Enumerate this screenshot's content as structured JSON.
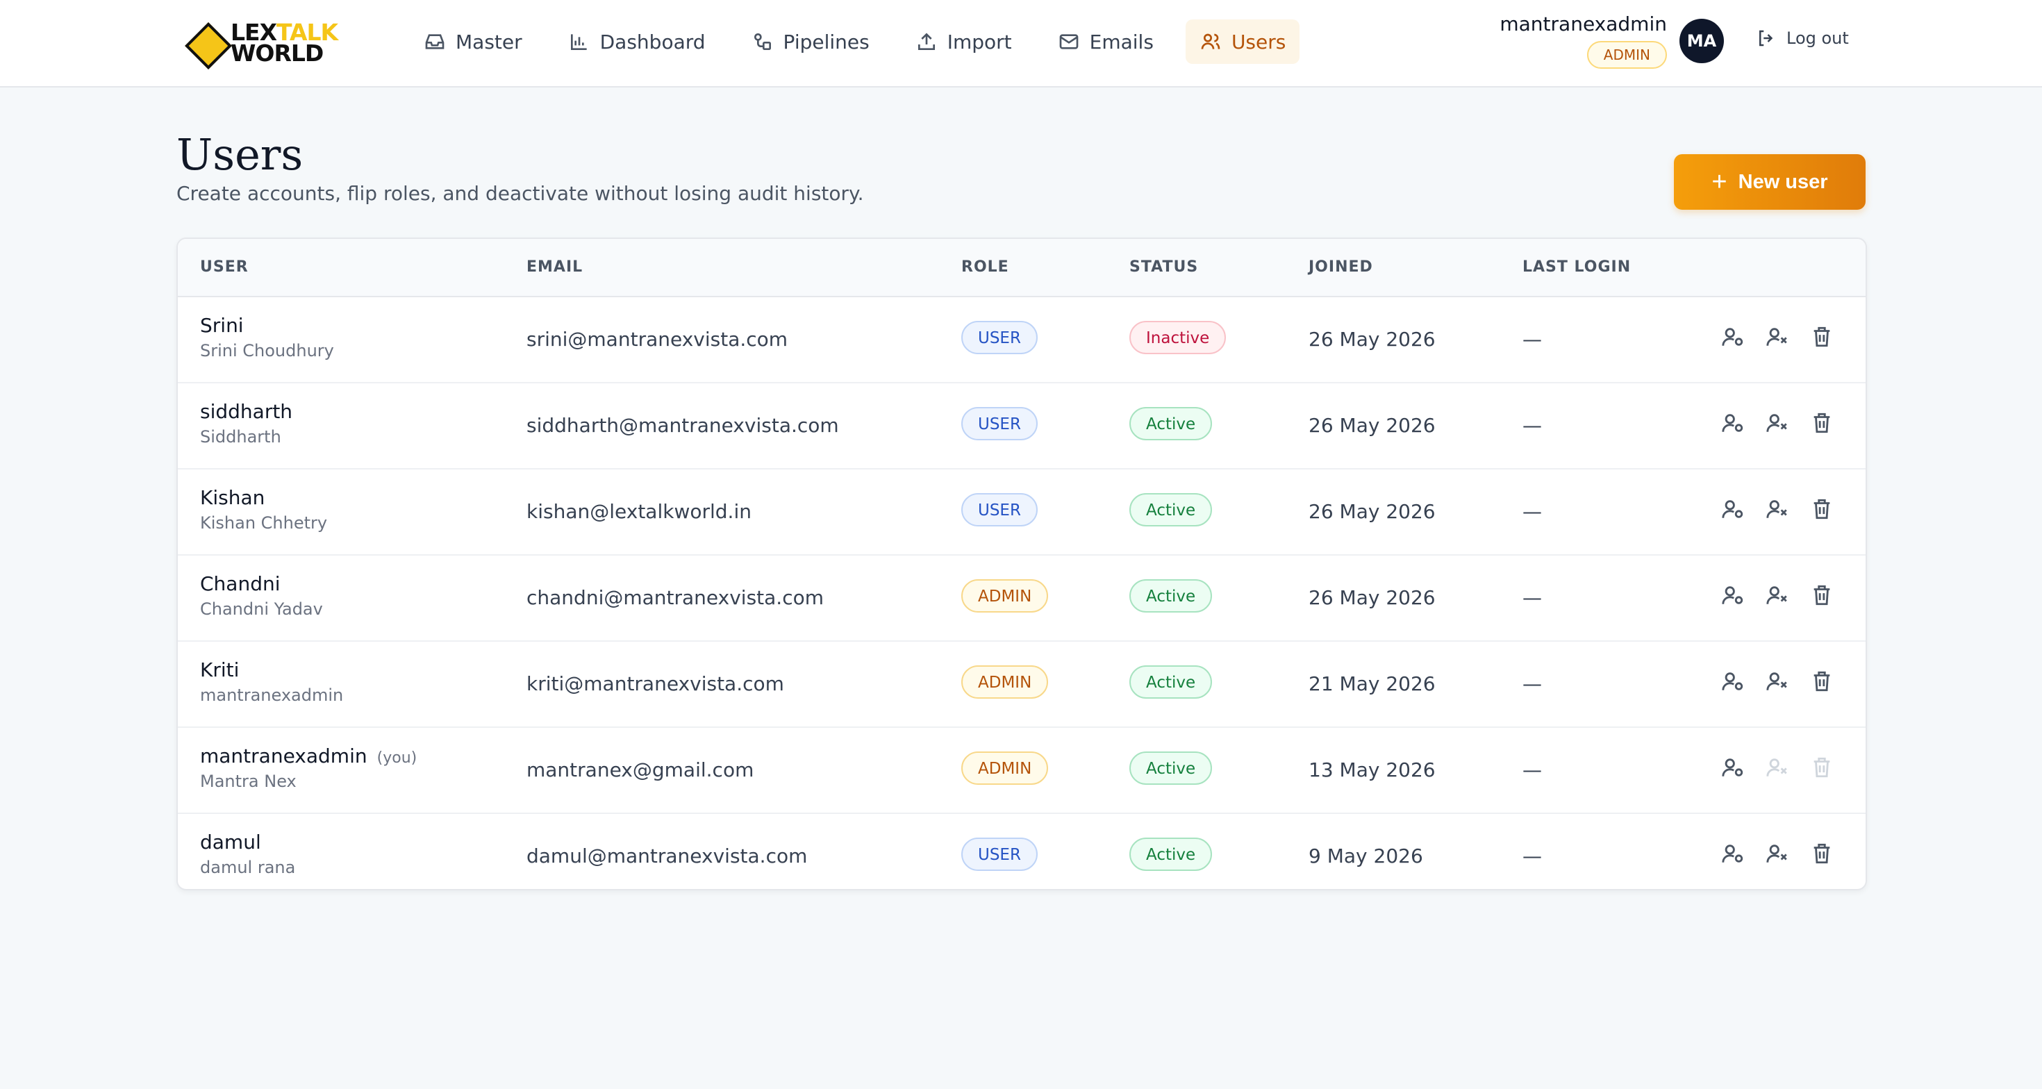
{
  "brand": {
    "line1_a": "LEX",
    "line1_b": "TALK",
    "line2": "WORLD"
  },
  "nav": [
    {
      "label": "Master",
      "icon": "inbox-icon"
    },
    {
      "label": "Dashboard",
      "icon": "bar-chart-icon"
    },
    {
      "label": "Pipelines",
      "icon": "pipeline-icon"
    },
    {
      "label": "Import",
      "icon": "upload-icon"
    },
    {
      "label": "Emails",
      "icon": "mail-icon"
    },
    {
      "label": "Users",
      "icon": "users-icon",
      "active": true
    }
  ],
  "account": {
    "username": "mantranexadmin",
    "role": "ADMIN",
    "initials": "MA",
    "logout_label": "Log out"
  },
  "page": {
    "title": "Users",
    "subtitle": "Create accounts, flip roles, and deactivate without losing audit history.",
    "new_button_label": "New user"
  },
  "table": {
    "columns": [
      "USER",
      "EMAIL",
      "ROLE",
      "STATUS",
      "JOINED",
      "LAST LOGIN"
    ],
    "rows": [
      {
        "name": "Srini",
        "full_name": "Srini Choudhury",
        "you": "",
        "email": "srini@mantranexvista.com",
        "role": "USER",
        "status": "Inactive",
        "joined": "26 May 2026",
        "last_login": "—"
      },
      {
        "name": "siddharth",
        "full_name": "Siddharth",
        "you": "",
        "email": "siddharth@mantranexvista.com",
        "role": "USER",
        "status": "Active",
        "joined": "26 May 2026",
        "last_login": "—"
      },
      {
        "name": "Kishan",
        "full_name": "Kishan Chhetry",
        "you": "",
        "email": "kishan@lextalkworld.in",
        "role": "USER",
        "status": "Active",
        "joined": "26 May 2026",
        "last_login": "—"
      },
      {
        "name": "Chandni",
        "full_name": "Chandni Yadav",
        "you": "",
        "email": "chandni@mantranexvista.com",
        "role": "ADMIN",
        "status": "Active",
        "joined": "26 May 2026",
        "last_login": "—"
      },
      {
        "name": "Kriti",
        "full_name": "mantranexadmin",
        "you": "",
        "email": "kriti@mantranexvista.com",
        "role": "ADMIN",
        "status": "Active",
        "joined": "21 May 2026",
        "last_login": "—"
      },
      {
        "name": "mantranexadmin",
        "full_name": "Mantra Nex",
        "you": "(you)",
        "email": "mantranex@gmail.com",
        "role": "ADMIN",
        "status": "Active",
        "joined": "13 May 2026",
        "last_login": "—"
      },
      {
        "name": "damul",
        "full_name": "damul rana",
        "you": "",
        "email": "damul@mantranexvista.com",
        "role": "USER",
        "status": "Active",
        "joined": "9 May 2026",
        "last_login": "—"
      }
    ]
  },
  "colors": {
    "accent": "#f59e0b",
    "active_nav_bg": "#fdf5e6",
    "avatar_bg": "#0f172a"
  }
}
